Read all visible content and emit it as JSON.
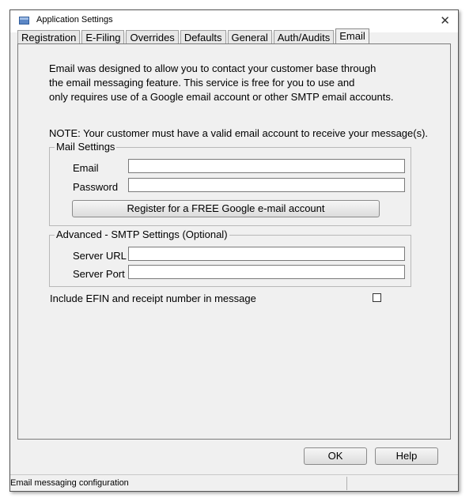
{
  "window": {
    "title": "Application Settings",
    "close_glyph": "✕"
  },
  "tabs": [
    {
      "label": "Registration"
    },
    {
      "label": "E-Filing"
    },
    {
      "label": "Overrides"
    },
    {
      "label": "Defaults"
    },
    {
      "label": "General"
    },
    {
      "label": "Auth/Audits"
    },
    {
      "label": "Email",
      "active": true
    }
  ],
  "intro": {
    "line1": "Email was designed to allow you to contact your customer base through",
    "line2": "the email messaging feature.  This service is free for you to use and",
    "line3": "only requires use of a Google email account or other SMTP email accounts."
  },
  "note": "NOTE:  Your customer must have a valid email account to receive your message(s).",
  "mail_settings": {
    "legend": "Mail Settings",
    "email_label": "Email",
    "email_value": "",
    "password_label": "Password",
    "password_value": "",
    "register_button": "Register for a FREE Google e-mail account"
  },
  "smtp_settings": {
    "legend": "Advanced - SMTP Settings (Optional)",
    "server_url_label": "Server URL",
    "server_url_value": "",
    "server_port_label": "Server Port",
    "server_port_value": ""
  },
  "include_option": {
    "label": "Include EFIN and receipt number in message",
    "checked": false
  },
  "buttons": {
    "ok": "OK",
    "help": "Help"
  },
  "status": "Email messaging configuration"
}
